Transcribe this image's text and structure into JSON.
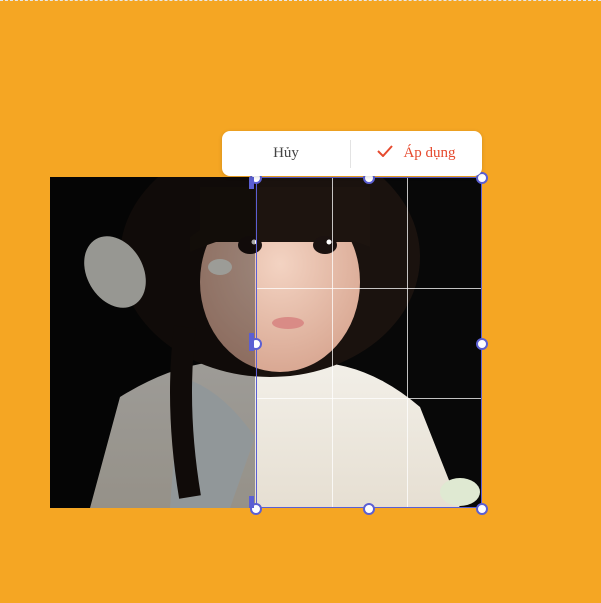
{
  "toolbar": {
    "cancel_label": "Hủy",
    "apply_label": "Áp dụng",
    "apply_icon": "checkmark-icon"
  },
  "colors": {
    "canvas_background": "#F5A623",
    "accent": "#5b5fd3",
    "apply": "#E64A2E"
  }
}
